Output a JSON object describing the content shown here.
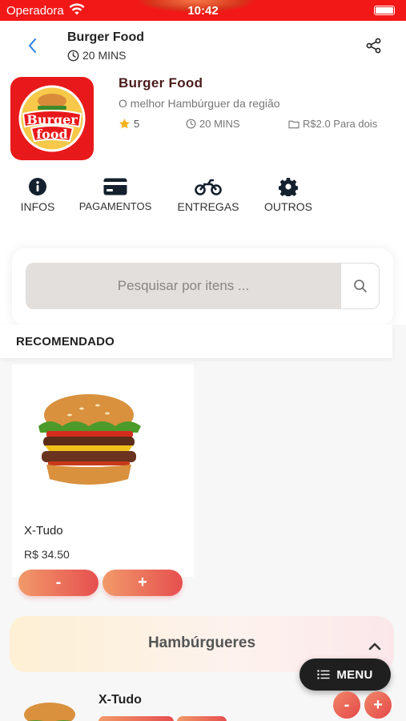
{
  "status_bar": {
    "carrier": "Operadora",
    "time": "10:42"
  },
  "header": {
    "title": "Burger Food",
    "time": "20 MINS"
  },
  "store": {
    "logo_text": [
      "Burger",
      "food"
    ],
    "name": "Burger Food",
    "description": "O melhor Hambúrguer da região",
    "rating": "5",
    "delivery_time": "20 MINS",
    "price_info": "R$2.0 Para dois"
  },
  "tabs": [
    {
      "label": "INFOS",
      "icon": "info-icon"
    },
    {
      "label": "PAGAMENTOS",
      "icon": "credit-card-icon"
    },
    {
      "label": "ENTREGAS",
      "icon": "motorcycle-icon"
    },
    {
      "label": "OUTROS",
      "icon": "gear-icon"
    }
  ],
  "search": {
    "placeholder": "Pesquisar por itens ..."
  },
  "recommended": {
    "title": "RECOMENDADO",
    "product": {
      "name": "X-Tudo",
      "price": "R$ 34.50",
      "minus_label": "-",
      "plus_label": "+"
    }
  },
  "category": {
    "title": "Hambúrgueres"
  },
  "list_item": {
    "name": "X-Tudo",
    "minus_label": "-",
    "plus_label": "+"
  },
  "menu_button": {
    "label": "MENU"
  },
  "colors": {
    "status_bar": "#f21818",
    "accent_start": "#f19a69",
    "accent_end": "#e64f4f",
    "menu_bg": "#1f1f1f"
  }
}
